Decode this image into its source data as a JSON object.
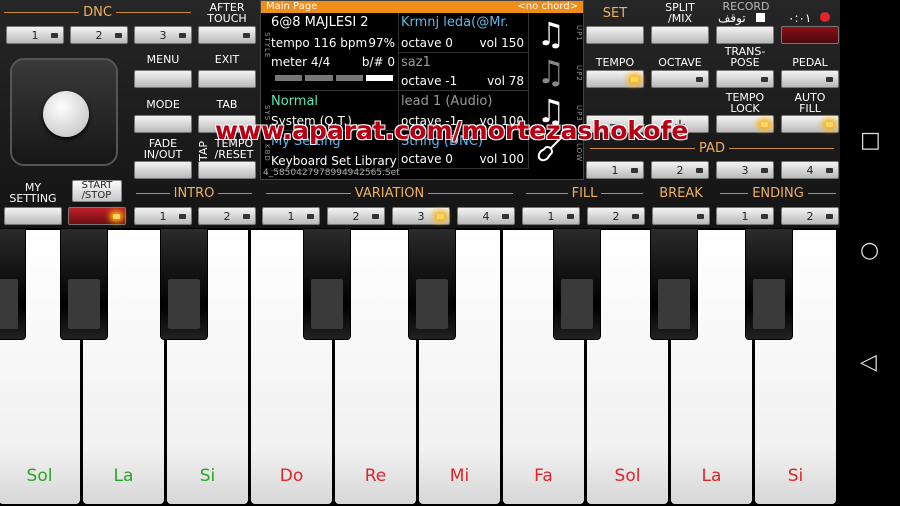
{
  "sections": {
    "dnc": "DNC",
    "pad": "PAD",
    "intro": "INTRO",
    "variation": "VARIATION",
    "fill": "FILL",
    "break": "BREAK",
    "ending": "ENDING"
  },
  "labels": {
    "after_touch": "AFTER\nTOUCH",
    "menu": "MENU",
    "exit": "EXIT",
    "mode": "MODE",
    "tab": "TAB",
    "fade": "FADE\nIN/OUT",
    "tap": "TAP",
    "tempo_reset": "TEMPO\n/RESET",
    "my_setting": "MY\nSETTING",
    "start_stop": "START\n/STOP",
    "set": "SET",
    "split_mix": "SPLIT\n/MIX",
    "record": "RECORD",
    "tempo": "TEMPO",
    "octave": "OCTAVE",
    "transpose": "TRANS-\nPOSE",
    "pedal": "PEDAL",
    "tempo_lock": "TEMPO\nLOCK",
    "auto_fill": "AUTO\nFILL",
    "minus": "−",
    "plus": "+"
  },
  "numbers": {
    "n1": "1",
    "n2": "2",
    "n3": "3",
    "n4": "4"
  },
  "screen": {
    "title": "Main Page",
    "chord": "<no chord>",
    "style_name": "6@8 MAJLESI 2",
    "tempo": "tempo 116 bpm",
    "tempo_pct": "97%",
    "meter": "meter 4/4",
    "key": "b/# 0",
    "sys_name": "Normal",
    "sys_sub": "System (Q.T.)",
    "kbd_name": "My Setting",
    "kbd_sub": "Keyboard Set Library",
    "file": "4_5850427978994942565.Set",
    "side_style": "STYLE",
    "side_sys": "SYS",
    "side_kbd": "KBD",
    "side_up1": "UP1",
    "side_up2": "UP2",
    "side_up3": "UP3",
    "side_low": "LOW",
    "parts": [
      {
        "name": "Krmnj leda(@Mr.",
        "octave": "octave 0",
        "vol": "vol 150"
      },
      {
        "name": "saz1",
        "octave": "octave -1",
        "vol": "vol 78"
      },
      {
        "name": "lead 1 (Audio)",
        "octave": "octave -1",
        "vol": "vol 100"
      },
      {
        "name": "String (DNC)",
        "octave": "octave 0",
        "vol": "vol 100"
      }
    ]
  },
  "status": {
    "pause": "توقف",
    "signal": "٠:٠١"
  },
  "keys": {
    "labels": [
      "Sol",
      "La",
      "Si",
      "Do",
      "Re",
      "Mi",
      "Fa",
      "Sol",
      "La",
      "Si"
    ],
    "colors": [
      "#27a527",
      "#27a527",
      "#27a527",
      "#e0242a",
      "#e0242a",
      "#e0242a",
      "#e0242a",
      "#e0242a",
      "#e0242a",
      "#e0242a"
    ]
  },
  "watermark": "www.aparat.com/mortezashokofe",
  "nav": {
    "recents": "□",
    "home": "○",
    "back": "◁"
  }
}
